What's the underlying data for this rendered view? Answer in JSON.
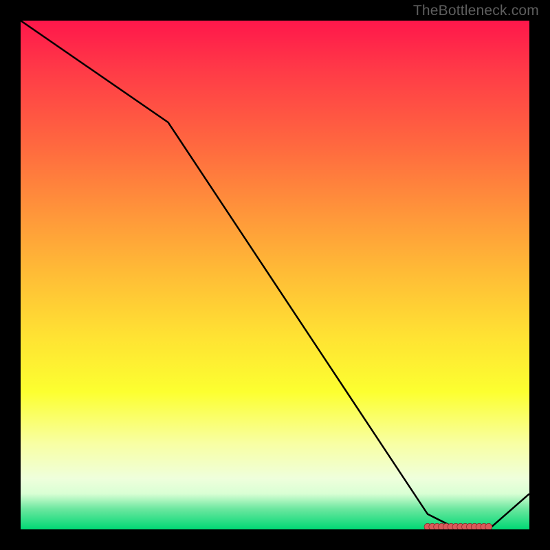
{
  "attribution": "TheBottleneck.com",
  "chart_data": {
    "type": "line",
    "title": "",
    "xlabel": "",
    "ylabel": "",
    "x": [
      0.0,
      0.29,
      0.8,
      0.86,
      0.9,
      0.92,
      1.0
    ],
    "y": [
      1.0,
      0.8,
      0.03,
      0.0,
      0.0,
      0.0,
      0.07
    ],
    "xlim": [
      0,
      1
    ],
    "ylim": [
      0,
      1
    ],
    "marker_cluster": {
      "x_range": [
        0.8,
        0.92
      ],
      "y": 0.005,
      "count": 14,
      "color": "#d95a5a",
      "radius": 5
    },
    "line_color": "#000000",
    "line_width": 2.5
  }
}
